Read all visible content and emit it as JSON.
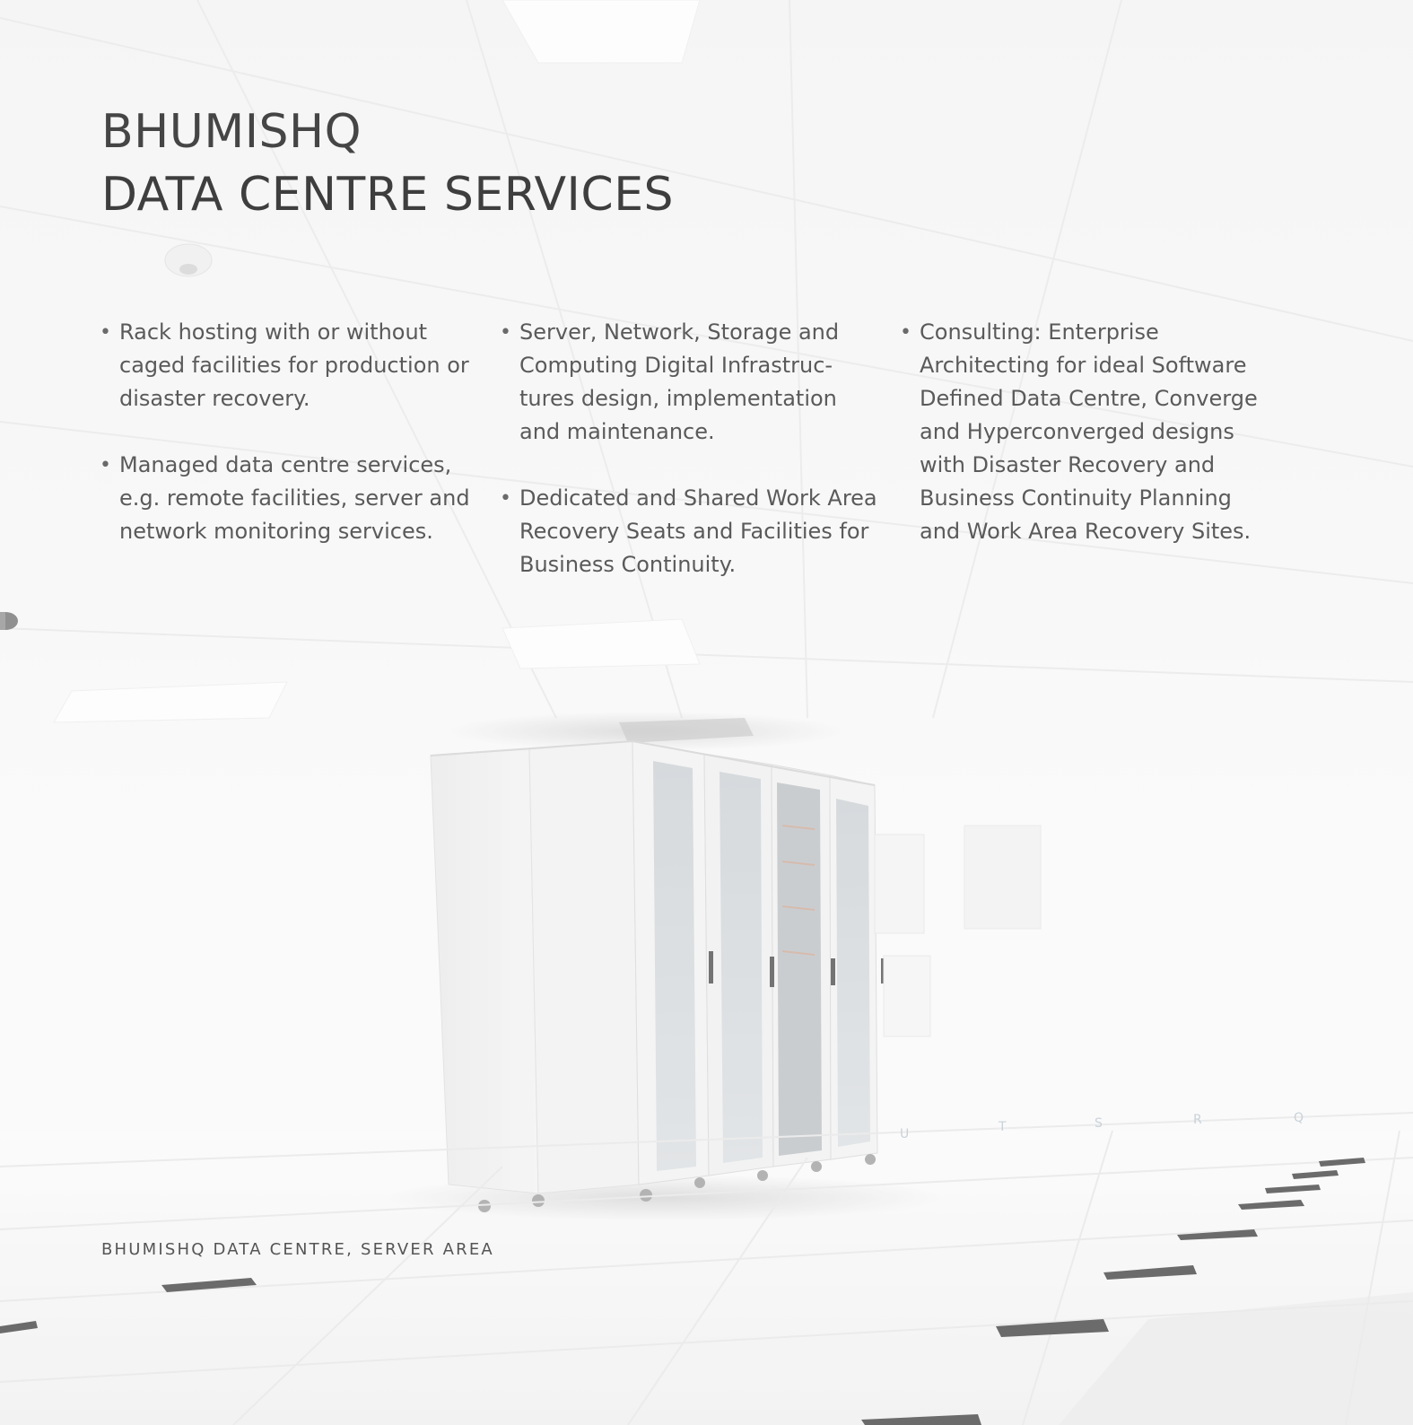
{
  "title": {
    "line1": "BHUMISHQ",
    "line2": "DATA CENTRE SERVICES"
  },
  "columns": [
    {
      "items": [
        [
          "Rack hosting with or without",
          "caged facilities for production or",
          "disaster recovery."
        ],
        [
          "Managed data centre services,",
          "e.g. remote facilities, server and",
          "network monitoring services."
        ]
      ]
    },
    {
      "items": [
        [
          "Server, Network, Storage and",
          "Computing Digital Infrastruc-",
          "tures design, implementation",
          "and maintenance."
        ],
        [
          "Dedicated and Shared Work Area",
          "Recovery Seats and Facilities for",
          "Business Continuity."
        ]
      ]
    },
    {
      "items": [
        [
          "Consulting: Enterprise",
          "Architecting for ideal Software",
          "Defined Data Centre, Converge",
          "and Hyperconverged designs",
          "with Disaster Recovery and",
          "Business Continuity Planning",
          "and Work Area Recovery Sites."
        ]
      ]
    }
  ],
  "bullet_symbol": "•",
  "caption": "BHUMISHQ DATA CENTRE, SERVER AREA"
}
